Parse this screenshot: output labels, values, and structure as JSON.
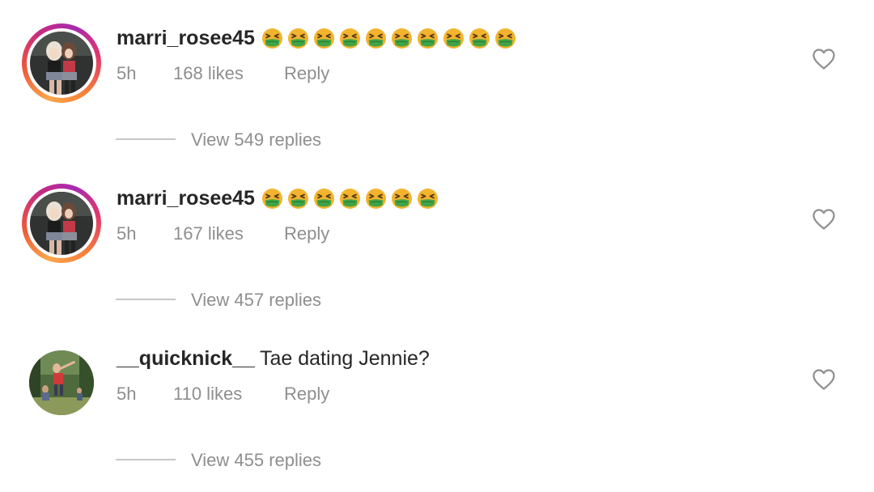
{
  "comments": [
    {
      "username": "marri_rosee45",
      "text": "",
      "emoji_icon": "nauseated-face-emoji",
      "emoji_count": 10,
      "time": "5h",
      "likes": "168 likes",
      "reply_label": "Reply",
      "view_replies": "View 549 replies",
      "avatar_ring": true
    },
    {
      "username": "marri_rosee45",
      "text": "",
      "emoji_icon": "nauseated-face-emoji",
      "emoji_count": 7,
      "time": "5h",
      "likes": "167 likes",
      "reply_label": "Reply",
      "view_replies": "View 457 replies",
      "avatar_ring": true
    },
    {
      "username": "__quicknick__",
      "text": "Tae dating Jennie?",
      "emoji_icon": "",
      "emoji_count": 0,
      "time": "5h",
      "likes": "110 likes",
      "reply_label": "Reply",
      "view_replies": "View 455 replies",
      "avatar_ring": false
    }
  ],
  "colors": {
    "text_primary": "#262626",
    "text_secondary": "#8e8e8e",
    "divider": "#c7c7c7",
    "emoji_face": "#f2b42f",
    "emoji_mouth": "#3fa447"
  },
  "icons": {
    "like": "heart-outline-icon"
  }
}
